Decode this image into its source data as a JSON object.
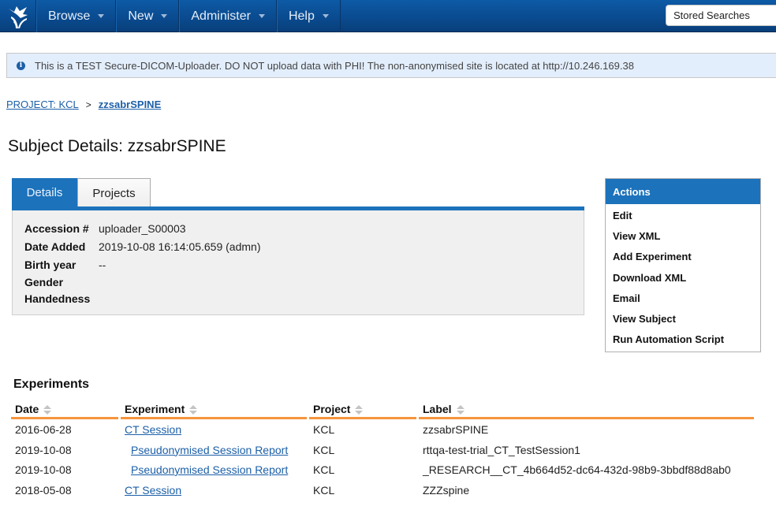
{
  "nav": {
    "items": [
      {
        "label": "Browse"
      },
      {
        "label": "New"
      },
      {
        "label": "Administer"
      },
      {
        "label": "Help"
      }
    ],
    "stored_searches": "Stored Searches"
  },
  "notice": {
    "text": "This is a TEST Secure-DICOM-Uploader. DO NOT upload data with PHI! The non-anonymised site is located at http://10.246.169.38"
  },
  "breadcrumb": {
    "project": "PROJECT: KCL",
    "separator": ">",
    "current": "zzsabrSPINE"
  },
  "page_title": "Subject Details: zzsabrSPINE",
  "tabs": [
    {
      "label": "Details",
      "active": true
    },
    {
      "label": "Projects",
      "active": false
    }
  ],
  "details": [
    {
      "label": "Accession #",
      "value": "uploader_S00003"
    },
    {
      "label": "Date Added",
      "value": "2019-10-08 16:14:05.659 (admn)"
    },
    {
      "label": "Birth year",
      "value": "--"
    },
    {
      "label": "Gender",
      "value": ""
    },
    {
      "label": "Handedness",
      "value": ""
    }
  ],
  "actions": {
    "title": "Actions",
    "items": [
      "Edit",
      "View XML",
      "Add Experiment",
      "Download XML",
      "Email",
      "View Subject",
      "Run Automation Script"
    ]
  },
  "experiments": {
    "title": "Experiments",
    "columns": [
      "Date",
      "Experiment",
      "Project",
      "Label"
    ],
    "rows": [
      {
        "date": "2016-06-28",
        "experiment": "CT Session",
        "indent": false,
        "project": "KCL",
        "label": "zzsabrSPINE"
      },
      {
        "date": "2019-10-08",
        "experiment": "Pseudonymised Session Report",
        "indent": true,
        "project": "KCL",
        "label": "rttqa-test-trial_CT_TestSession1"
      },
      {
        "date": "2019-10-08",
        "experiment": "Pseudonymised Session Report",
        "indent": true,
        "project": "KCL",
        "label": "_RESEARCH__CT_4b664d52-dc64-432d-98b9-3bbdf88d8ab0"
      },
      {
        "date": "2018-05-08",
        "experiment": "CT Session",
        "indent": false,
        "project": "KCL",
        "label": "ZZZspine"
      }
    ]
  },
  "colors": {
    "nav_bg": "#0a4b90",
    "accent_blue": "#1c72bb",
    "link": "#1c5fa8",
    "table_header_rule": "#f5943b",
    "notice_bg": "#e3eefc"
  }
}
